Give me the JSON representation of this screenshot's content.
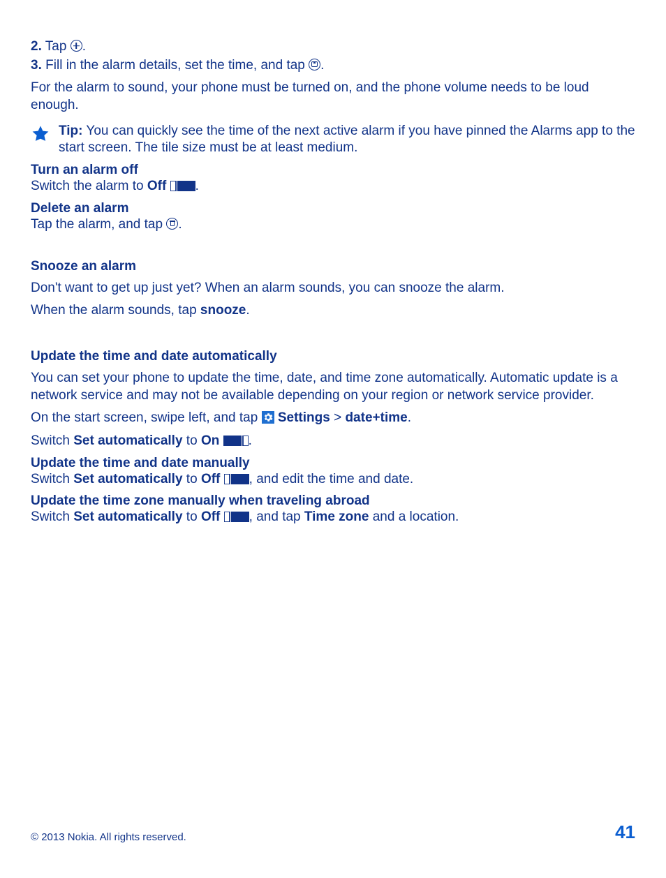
{
  "steps": {
    "s2_num": "2.",
    "s2_text": "Tap",
    "s2_after": ".",
    "s3_num": "3.",
    "s3_text": "Fill in the alarm details, set the time, and tap",
    "s3_after": "."
  },
  "p_alarm_on": "For the alarm to sound, your phone must be turned on, and the phone volume needs to be loud enough.",
  "tip": {
    "label": "Tip:",
    "text": " You can quickly see the time of the next active alarm if you have pinned the Alarms app to the start screen. The tile size must be at least medium."
  },
  "turn_off": {
    "heading": "Turn an alarm off",
    "pre": "Switch the alarm to ",
    "off": "Off",
    "post": "."
  },
  "delete": {
    "heading": "Delete an alarm",
    "pre": "Tap the alarm, and tap ",
    "post": "."
  },
  "snooze": {
    "heading": "Snooze an alarm",
    "p1": "Don't want to get up just yet? When an alarm sounds, you can snooze the alarm.",
    "p2_pre": "When the alarm sounds, tap ",
    "p2_bold": "snooze",
    "p2_post": "."
  },
  "auto": {
    "heading": "Update the time and date automatically",
    "p1": "You can set your phone to update the time, date, and time zone automatically. Automatic update is a network service and may not be available depending on your region or network service provider.",
    "p2_pre": "On the start screen, swipe left, and tap ",
    "settings": "Settings",
    "gt": " > ",
    "datetime": "date+time",
    "p2_post": ".",
    "p3_pre": "Switch ",
    "p3_setauto": "Set automatically",
    "p3_to": " to ",
    "p3_on": "On",
    "p3_post": "."
  },
  "manual": {
    "heading": "Update the time and date manually",
    "pre": "Switch ",
    "setauto": "Set automatically",
    "to": " to ",
    "off": "Off",
    "post": ", and edit the time and date."
  },
  "tz": {
    "heading": "Update the time zone manually when traveling abroad",
    "pre": "Switch ",
    "setauto": "Set automatically",
    "to": " to ",
    "off": "Off",
    "mid": ", and tap ",
    "timezone": "Time zone",
    "post": " and a location."
  },
  "footer": {
    "copyright": "© 2013 Nokia. All rights reserved.",
    "page": "41"
  }
}
